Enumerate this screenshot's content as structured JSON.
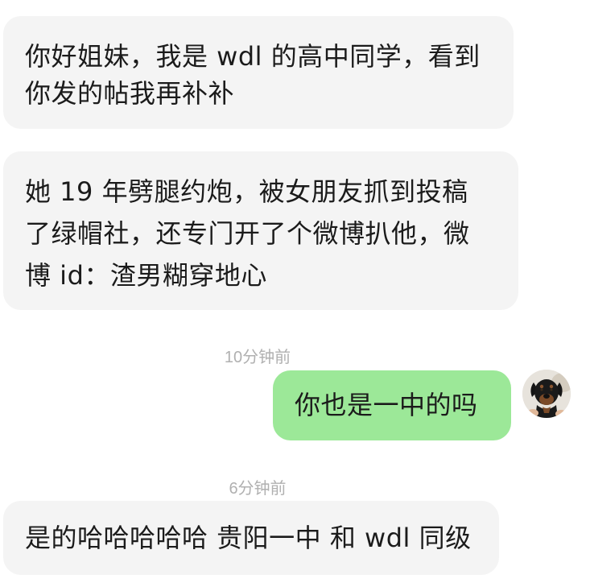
{
  "messages": [
    {
      "sender": "other",
      "lines": [
        "你好姐妹，我是 wdl 的高中同学，看到",
        "你发的帖我再补补"
      ]
    },
    {
      "sender": "other",
      "lines": [
        "她 19 年劈腿约炮，被女朋友抓到投稿",
        "了绿帽社，还专门开了个微博扒他，微",
        "博 id：渣男糊穿地心"
      ]
    },
    {
      "timestamp": "10分钟前"
    },
    {
      "sender": "me",
      "lines": [
        "你也是一中的吗"
      ],
      "avatar": "rottweiler-dog-avatar"
    },
    {
      "timestamp": "6分钟前"
    },
    {
      "sender": "other",
      "lines": [
        "是的哈哈哈哈哈 贵阳一中 和 wdl 同级"
      ]
    }
  ],
  "colors": {
    "incoming_bubble": "#f4f4f4",
    "outgoing_bubble": "#9ce898",
    "timestamp_text": "#b0b0b0",
    "message_text": "#1b1b1b"
  }
}
